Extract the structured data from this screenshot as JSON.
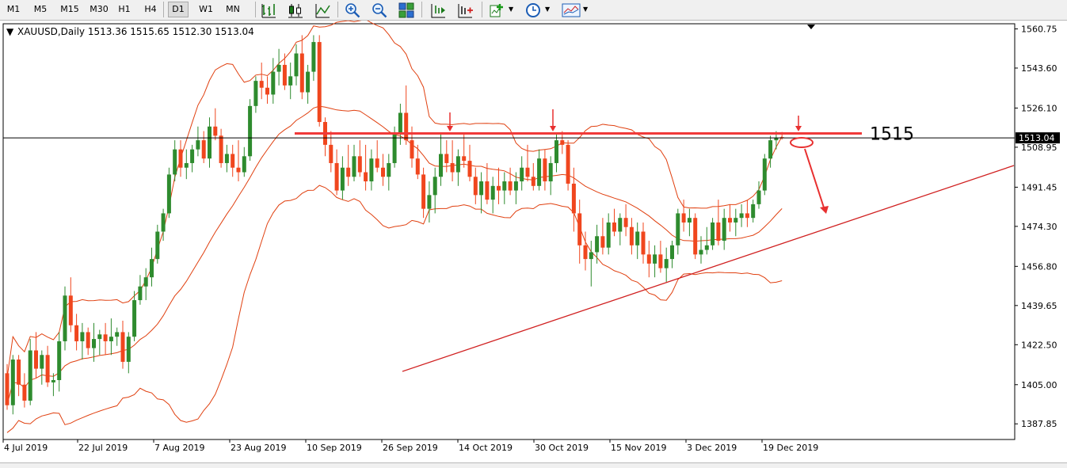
{
  "toolbar": {
    "timeframes": [
      {
        "label": "M1",
        "active": false
      },
      {
        "label": "M5",
        "active": false
      },
      {
        "label": "M15",
        "active": false
      },
      {
        "label": "M30",
        "active": false
      },
      {
        "label": "H1",
        "active": false
      },
      {
        "label": "H4",
        "active": false
      },
      {
        "label": "D1",
        "active": true
      },
      {
        "label": "W1",
        "active": false
      },
      {
        "label": "MN",
        "active": false
      }
    ],
    "icons": [
      "bar-chart-icon",
      "candlestick-icon",
      "line-chart-icon",
      "zoom-in-icon",
      "zoom-out-icon",
      "tile-windows-icon",
      "autoscroll-icon",
      "chart-shift-icon",
      "indicators-icon",
      "periods-icon",
      "templates-icon"
    ]
  },
  "chart": {
    "header": "XAUUSD,Daily  1513.36 1515.65 1512.30 1513.04",
    "current_price_label": "1513.04",
    "annotation_label": "1515",
    "price_ticks": [
      "1560.75",
      "1543.60",
      "1526.10",
      "1508.95",
      "1491.45",
      "1474.30",
      "1456.80",
      "1439.65",
      "1422.50",
      "1405.00",
      "1387.85"
    ],
    "date_ticks": [
      "4 Jul 2019",
      "22 Jul 2019",
      "7 Aug 2019",
      "23 Aug 2019",
      "10 Sep 2019",
      "26 Sep 2019",
      "14 Oct 2019",
      "30 Oct 2019",
      "15 Nov 2019",
      "3 Dec 2019",
      "19 Dec 2019"
    ],
    "colors": {
      "bull": "#2e8b2e",
      "bear": "#f0461e",
      "band": "#e04010",
      "resistance": "#f03a3a",
      "trendline": "#d02020",
      "arrow": "#e83030",
      "grid_line": "#000000"
    }
  },
  "chart_data": {
    "type": "candlestick",
    "symbol": "XAUUSD",
    "timeframe": "Daily",
    "last_bar": {
      "open": 1513.36,
      "high": 1515.65,
      "low": 1512.3,
      "close": 1513.04
    },
    "resistance_level": 1515,
    "ylim": [
      1381,
      1563
    ],
    "candles": [
      [
        1410,
        1414,
        1394,
        1396
      ],
      [
        1396,
        1418,
        1392,
        1416
      ],
      [
        1416,
        1418,
        1400,
        1405
      ],
      [
        1405,
        1410,
        1395,
        1398
      ],
      [
        1398,
        1425,
        1396,
        1420
      ],
      [
        1420,
        1428,
        1408,
        1412
      ],
      [
        1412,
        1420,
        1405,
        1418
      ],
      [
        1418,
        1422,
        1404,
        1406
      ],
      [
        1406,
        1410,
        1400,
        1407
      ],
      [
        1407,
        1428,
        1402,
        1424
      ],
      [
        1424,
        1448,
        1420,
        1444
      ],
      [
        1444,
        1452,
        1428,
        1431
      ],
      [
        1431,
        1436,
        1420,
        1424
      ],
      [
        1424,
        1432,
        1416,
        1428
      ],
      [
        1428,
        1430,
        1418,
        1421
      ],
      [
        1421,
        1432,
        1415,
        1425
      ],
      [
        1425,
        1429,
        1418,
        1427
      ],
      [
        1427,
        1432,
        1418,
        1424
      ],
      [
        1424,
        1434,
        1418,
        1426
      ],
      [
        1426,
        1430,
        1422,
        1428
      ],
      [
        1428,
        1433,
        1412,
        1415
      ],
      [
        1415,
        1428,
        1410,
        1426
      ],
      [
        1426,
        1446,
        1424,
        1442
      ],
      [
        1442,
        1453,
        1440,
        1448
      ],
      [
        1448,
        1456,
        1442,
        1452
      ],
      [
        1452,
        1465,
        1448,
        1460
      ],
      [
        1460,
        1475,
        1458,
        1472
      ],
      [
        1472,
        1482,
        1468,
        1480
      ],
      [
        1480,
        1500,
        1478,
        1497
      ],
      [
        1497,
        1512,
        1494,
        1508
      ],
      [
        1508,
        1512,
        1496,
        1500
      ],
      [
        1500,
        1508,
        1495,
        1502
      ],
      [
        1502,
        1510,
        1498,
        1508
      ],
      [
        1508,
        1518,
        1505,
        1512
      ],
      [
        1512,
        1516,
        1502,
        1504
      ],
      [
        1504,
        1522,
        1500,
        1518
      ],
      [
        1518,
        1526,
        1512,
        1514
      ],
      [
        1514,
        1517,
        1500,
        1502
      ],
      [
        1502,
        1510,
        1498,
        1506
      ],
      [
        1506,
        1510,
        1496,
        1500
      ],
      [
        1500,
        1512,
        1494,
        1498
      ],
      [
        1498,
        1509,
        1496,
        1505
      ],
      [
        1505,
        1530,
        1503,
        1527
      ],
      [
        1527,
        1540,
        1524,
        1538
      ],
      [
        1538,
        1546,
        1530,
        1535
      ],
      [
        1535,
        1540,
        1528,
        1532
      ],
      [
        1532,
        1548,
        1528,
        1542
      ],
      [
        1542,
        1552,
        1536,
        1545
      ],
      [
        1545,
        1550,
        1534,
        1536
      ],
      [
        1536,
        1546,
        1530,
        1540
      ],
      [
        1540,
        1554,
        1536,
        1550
      ],
      [
        1550,
        1558,
        1530,
        1533
      ],
      [
        1533,
        1545,
        1528,
        1542
      ],
      [
        1542,
        1558,
        1538,
        1555
      ],
      [
        1555,
        1558,
        1518,
        1520
      ],
      [
        1520,
        1522,
        1505,
        1510
      ],
      [
        1510,
        1516,
        1498,
        1502
      ],
      [
        1502,
        1508,
        1488,
        1490
      ],
      [
        1490,
        1505,
        1486,
        1500
      ],
      [
        1500,
        1510,
        1492,
        1496
      ],
      [
        1496,
        1510,
        1494,
        1505
      ],
      [
        1505,
        1512,
        1496,
        1498
      ],
      [
        1498,
        1510,
        1490,
        1494
      ],
      [
        1494,
        1508,
        1490,
        1504
      ],
      [
        1504,
        1512,
        1498,
        1500
      ],
      [
        1500,
        1506,
        1492,
        1496
      ],
      [
        1496,
        1506,
        1490,
        1502
      ],
      [
        1502,
        1518,
        1500,
        1515
      ],
      [
        1515,
        1528,
        1510,
        1524
      ],
      [
        1524,
        1536,
        1510,
        1512
      ],
      [
        1512,
        1518,
        1500,
        1504
      ],
      [
        1504,
        1510,
        1495,
        1497
      ],
      [
        1497,
        1500,
        1478,
        1482
      ],
      [
        1482,
        1494,
        1476,
        1488
      ],
      [
        1488,
        1500,
        1480,
        1496
      ],
      [
        1496,
        1515,
        1492,
        1506
      ],
      [
        1506,
        1512,
        1498,
        1502
      ],
      [
        1502,
        1512,
        1494,
        1498
      ],
      [
        1498,
        1508,
        1492,
        1505
      ],
      [
        1505,
        1515,
        1500,
        1503
      ],
      [
        1503,
        1510,
        1494,
        1496
      ],
      [
        1496,
        1500,
        1484,
        1488
      ],
      [
        1488,
        1498,
        1480,
        1494
      ],
      [
        1494,
        1502,
        1484,
        1486
      ],
      [
        1486,
        1496,
        1480,
        1492
      ],
      [
        1492,
        1500,
        1484,
        1490
      ],
      [
        1490,
        1498,
        1484,
        1494
      ],
      [
        1494,
        1500,
        1488,
        1490
      ],
      [
        1490,
        1498,
        1484,
        1494
      ],
      [
        1494,
        1505,
        1490,
        1500
      ],
      [
        1500,
        1510,
        1494,
        1496
      ],
      [
        1496,
        1502,
        1490,
        1492
      ],
      [
        1492,
        1508,
        1490,
        1504
      ],
      [
        1504,
        1508,
        1490,
        1494
      ],
      [
        1494,
        1505,
        1488,
        1502
      ],
      [
        1502,
        1515,
        1498,
        1512
      ],
      [
        1512,
        1516,
        1506,
        1510
      ],
      [
        1510,
        1512,
        1490,
        1493
      ],
      [
        1493,
        1500,
        1472,
        1480
      ],
      [
        1480,
        1486,
        1458,
        1466
      ],
      [
        1466,
        1472,
        1455,
        1460
      ],
      [
        1460,
        1468,
        1448,
        1463
      ],
      [
        1463,
        1475,
        1458,
        1470
      ],
      [
        1470,
        1478,
        1462,
        1465
      ],
      [
        1465,
        1480,
        1462,
        1476
      ],
      [
        1476,
        1482,
        1470,
        1472
      ],
      [
        1472,
        1480,
        1466,
        1478
      ],
      [
        1478,
        1484,
        1470,
        1474
      ],
      [
        1474,
        1478,
        1462,
        1466
      ],
      [
        1466,
        1476,
        1460,
        1472
      ],
      [
        1472,
        1476,
        1458,
        1462
      ],
      [
        1462,
        1468,
        1452,
        1458
      ],
      [
        1458,
        1466,
        1452,
        1462
      ],
      [
        1462,
        1468,
        1454,
        1456
      ],
      [
        1456,
        1465,
        1450,
        1460
      ],
      [
        1460,
        1468,
        1456,
        1466
      ],
      [
        1466,
        1482,
        1462,
        1480
      ],
      [
        1480,
        1486,
        1472,
        1476
      ],
      [
        1476,
        1482,
        1470,
        1478
      ],
      [
        1478,
        1480,
        1460,
        1462
      ],
      [
        1462,
        1470,
        1458,
        1464
      ],
      [
        1464,
        1474,
        1462,
        1466
      ],
      [
        1466,
        1478,
        1464,
        1476
      ],
      [
        1476,
        1486,
        1466,
        1468
      ],
      [
        1468,
        1482,
        1464,
        1478
      ],
      [
        1478,
        1484,
        1472,
        1476
      ],
      [
        1476,
        1482,
        1470,
        1478
      ],
      [
        1478,
        1484,
        1474,
        1480
      ],
      [
        1480,
        1486,
        1474,
        1478
      ],
      [
        1478,
        1486,
        1476,
        1484
      ],
      [
        1484,
        1494,
        1482,
        1490
      ],
      [
        1490,
        1506,
        1488,
        1504
      ],
      [
        1504,
        1514,
        1500,
        1512
      ],
      [
        1512,
        1516,
        1508,
        1513
      ],
      [
        1513.36,
        1515.65,
        1512.3,
        1513.04
      ]
    ]
  }
}
